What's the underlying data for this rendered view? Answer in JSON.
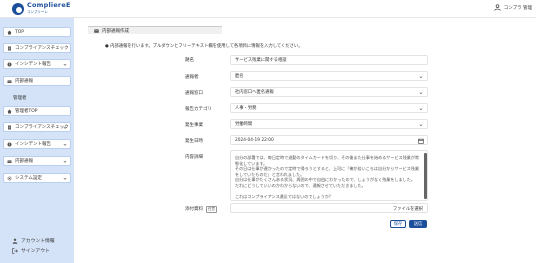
{
  "app": {
    "logo_name": "CompliereE",
    "logo_sub": "コンプリーレ",
    "user_label": "コンプラ 管理"
  },
  "sidebar": {
    "items": [
      {
        "label": "TOP"
      },
      {
        "label": "コンプライアンスチェック"
      },
      {
        "label": "インシデント報告"
      },
      {
        "label": "内部通報"
      },
      {
        "sub_label": "管理者"
      },
      {
        "label": "管理者TOP"
      },
      {
        "label": "コンプライアンスチェック"
      },
      {
        "label": "インシデント報告"
      },
      {
        "label": "内部通報"
      },
      {
        "label": "システム設定"
      }
    ],
    "account_label": "アカウント情報",
    "signout_label": "サインアウト"
  },
  "page": {
    "tab_title": "内部通報作成",
    "notice": "● 内部通報を行います。プルダウンとフリーテキスト欄を使用して各項目に情報を入力してください。"
  },
  "form": {
    "title_label": "題名",
    "title_value": "サービス残業に関する相談",
    "reporter_label": "通報者",
    "reporter_value": "匿名",
    "destination_label": "通報窓口",
    "destination_value": "社内窓口へ匿名通報",
    "category_label": "報告カテゴリ",
    "category_value": "人事・労務",
    "location_label": "発生事業",
    "location_value": "労働時間",
    "datetime_label": "発生日時",
    "datetime_value": "2024-04-19 22:00",
    "details_label": "内容詳細",
    "details_value": "自分の部署では、毎日定時で退勤のタイムカードを切り、その後また仕事を始めるサービス残業が常態化しています。\nその日は仕事が遅かったので定時で帰ろうとすると、上司に「俺が若いころは自分からサービス残業をしていたものだ」と言われました。\n自分は仕事がたくさんある状況、周囲の中で自由にわかったので、しょうがなく残業をしました。\nだれにどうしていいのかわからないので、通報させていただきました。\n\nこれはコンプライアンス違反ではないのでしょうか?\n匿名を希望させてください。",
    "attachment_label": "添付資料",
    "attachment_badge": "任意",
    "file_button": "ファイルを選択",
    "save_label": "保存",
    "submit_label": "送信"
  },
  "colors": {
    "brand": "#1b4e9b",
    "sidebar_bg": "#d4e3f7"
  }
}
